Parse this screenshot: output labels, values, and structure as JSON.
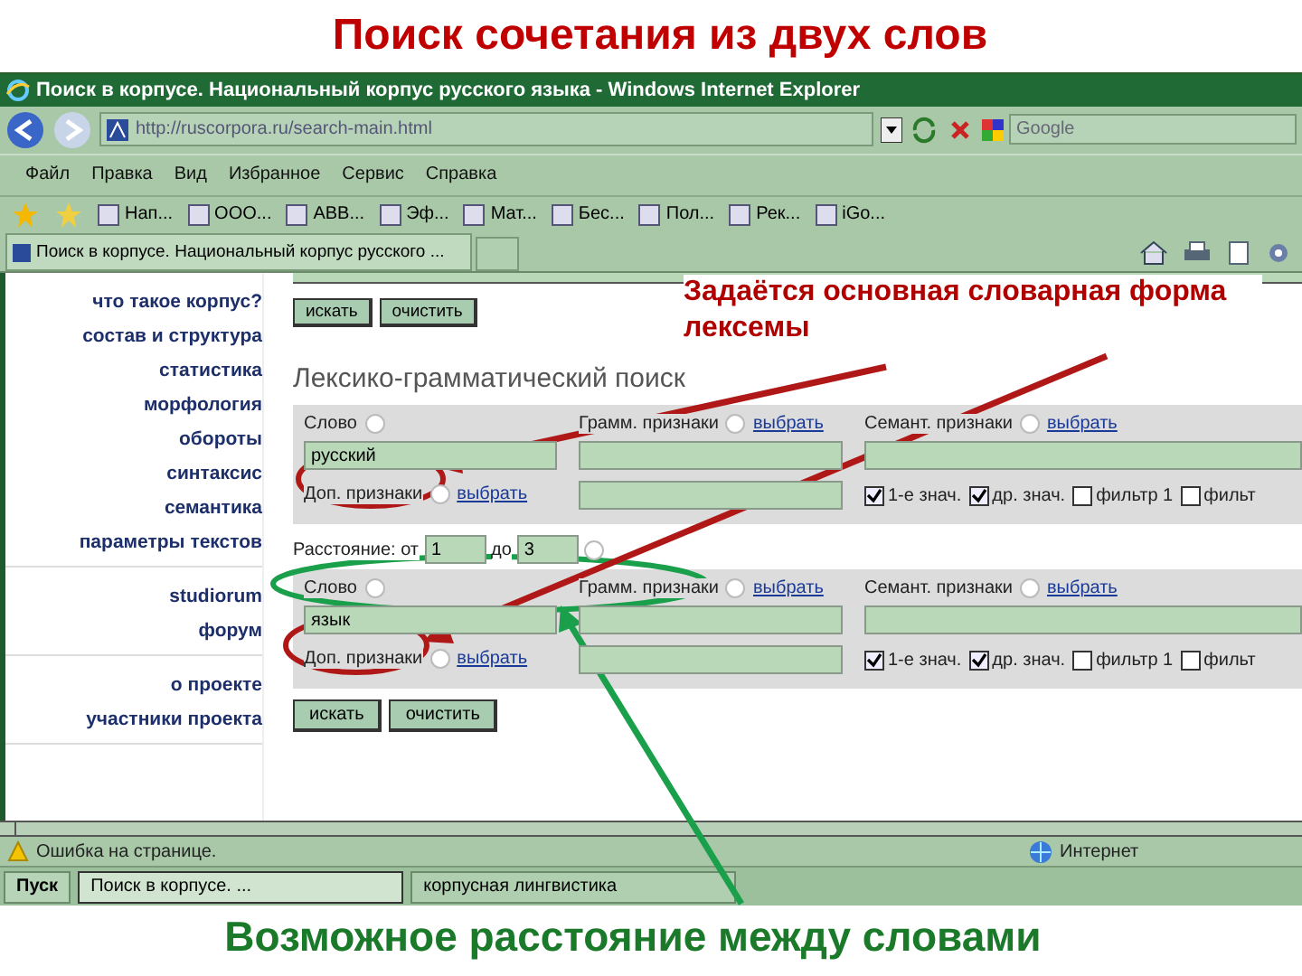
{
  "slide_title": "Поиск сочетания из двух слов",
  "window": {
    "title": "Поиск в корпусе. Национальный корпус русского языка - Windows Internet Explorer"
  },
  "address_bar": {
    "url": "http://ruscorpora.ru/search-main.html",
    "search_placeholder": "Google"
  },
  "menu": [
    "Файл",
    "Правка",
    "Вид",
    "Избранное",
    "Сервис",
    "Справка"
  ],
  "favorites": [
    "Нап...",
    "ООО...",
    "ABB...",
    "Эф...",
    "Мат...",
    "Бес...",
    "Пол...",
    "Рек...",
    "iGo..."
  ],
  "tab": {
    "title": "Поиск в корпусе. Национальный корпус русского ..."
  },
  "sidebar": {
    "groups": [
      [
        "что такое корпус?",
        "состав и структура",
        "статистика",
        "морфология",
        "обороты",
        "синтаксис",
        "семантика",
        "параметры текстов"
      ],
      [
        "studiorum",
        "форум"
      ],
      [
        "о проекте",
        "участники проекта"
      ]
    ]
  },
  "top_buttons": [
    "искать",
    "очистить"
  ],
  "form": {
    "heading": "Лексико-грамматический поиск",
    "blocks": [
      {
        "word_label": "Слово",
        "word": "русский",
        "extra_label": "Доп. признаки",
        "extra_link": "выбрать",
        "gram_label": "Грамм. признаки",
        "gram_link": "выбрать",
        "sem_label": "Семант. признаки",
        "sem_link": "выбрать",
        "options": [
          {
            "label": "1-е знач.",
            "checked": true
          },
          {
            "label": "др. знач.",
            "checked": true
          },
          {
            "label": "фильтр 1",
            "checked": false
          },
          {
            "label": "фильт",
            "checked": false
          }
        ]
      },
      {
        "word_label": "Слово",
        "word": "язык",
        "extra_label": "Доп. признаки",
        "extra_link": "выбрать",
        "gram_label": "Грамм. признаки",
        "gram_link": "выбрать",
        "sem_label": "Семант. признаки",
        "sem_link": "выбрать",
        "options": [
          {
            "label": "1-е знач.",
            "checked": true
          },
          {
            "label": "др. знач.",
            "checked": true
          },
          {
            "label": "фильтр 1",
            "checked": false
          },
          {
            "label": "фильт",
            "checked": false
          }
        ]
      }
    ],
    "distance": {
      "label": "Расстояние: от",
      "from": "1",
      "to_label": "до",
      "to": "3"
    }
  },
  "bottom_buttons": [
    "искать",
    "очистить"
  ],
  "annotations": {
    "lexeme_note": "Задаётся основная словарная форма лексемы",
    "distance_note": "Возможное расстояние между словами"
  },
  "status_bar": {
    "message": "Ошибка на странице.",
    "zone": "Интернет"
  },
  "taskbar": {
    "start": "Пуск",
    "items": [
      {
        "label": "Поиск в корпусе. ...",
        "selected": true
      },
      {
        "label": "корпусная лингвистика",
        "selected": false
      }
    ]
  }
}
